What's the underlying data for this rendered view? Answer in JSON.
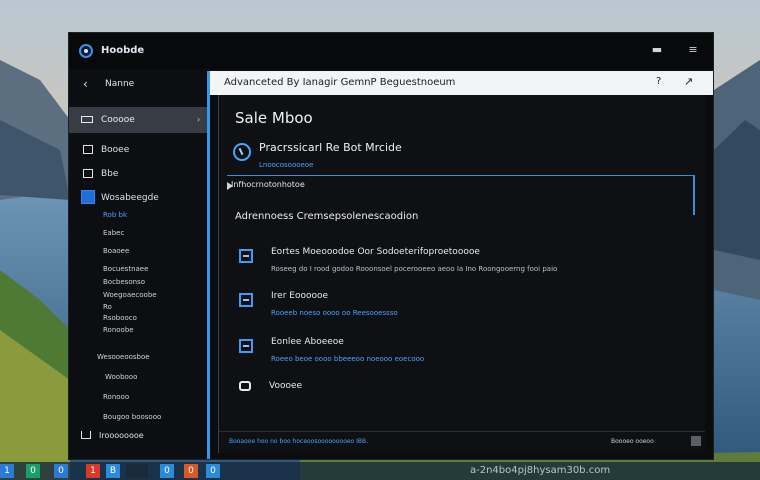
{
  "window": {
    "app_title": "Hoobde",
    "minimize_glyph": "▬",
    "menu_glyph": "≡"
  },
  "sidebar": {
    "back_label": "Nanne",
    "active_item": "Cooooe",
    "items": [
      {
        "label": "Booee",
        "icon": "square-icon"
      },
      {
        "label": "Bbe",
        "icon": "file-icon"
      },
      {
        "label": "Wosabeegde",
        "icon": "blue-square-icon",
        "highlight": true
      }
    ],
    "subitems": [
      {
        "label": "Rob bk",
        "blue": true
      },
      {
        "label": "Eabec",
        "blue": false
      },
      {
        "label": "Boaoee",
        "blue": false
      },
      {
        "label": "Bocuestnaee",
        "blue": false
      },
      {
        "label": "Bocbesonso",
        "blue": false
      },
      {
        "label": "Woegoaecoobe",
        "blue": false
      },
      {
        "label": "Ro",
        "blue": false
      },
      {
        "label": "Rsobooco",
        "blue": false
      },
      {
        "label": "Ronoobe",
        "blue": false
      },
      {
        "label": "Wesooeoosboe",
        "blue": false
      },
      {
        "label": "Woobooo",
        "blue": false
      },
      {
        "label": "Ronooo",
        "blue": false
      },
      {
        "label": "Bougoo boosooo",
        "blue": false
      }
    ],
    "bottom_label": "Iroooooooe"
  },
  "main": {
    "header_title": "Advanceted By Ianagir GemnP Beguestnoeum",
    "header_icon_1": "?",
    "header_icon_2": "↗",
    "section_title": "Sale Mboo",
    "feature_title": "Pracrssicarl Re Bot Mrcide",
    "feature_sub": "Lnoocosoooeoe",
    "focus_label": "Infhocrnotonhotoe",
    "group_title": "Adrennoess Cremsepsolenescaodion",
    "rows": [
      {
        "title": "Eortes Moeooodoe Oor Sodoeterifoproetooooe",
        "desc": "Roseeg do I rood godoo Rooonsoel pocerooeeo aeoo Ia Ino Roongooerng fooi paio",
        "blue": false
      },
      {
        "title": "Irer Eoooooe",
        "desc": "Rooeeb noeso oooo oo Reesooessso",
        "blue": true
      },
      {
        "title": "Eonlee Aboeeoe",
        "desc": "Roeeo beoe oooo bbeeeoo noeooo eoecooo",
        "blue": true
      }
    ],
    "vbox_label": "Voooee",
    "status_left": "Booaooe hoo no boo hoceoosooooooooeo IBB.",
    "status_right": "Boooeo ooeoo"
  },
  "taskbar": {
    "watermark": "a-2n4bo4pj8hysam30b.com",
    "icons": [
      {
        "glyph": "1",
        "color": "#2a7bd8"
      },
      {
        "glyph": "0",
        "color": "#1a9e6a"
      },
      {
        "glyph": "0",
        "color": "#2a7bd8"
      },
      {
        "glyph": "1",
        "color": "#d83a2a"
      },
      {
        "glyph": "B",
        "color": "#2a8bd8"
      },
      {
        "glyph": "",
        "color": "#1b2a3a"
      },
      {
        "glyph": "0",
        "color": "#2a8bd8"
      },
      {
        "glyph": "0",
        "color": "#d8582a"
      },
      {
        "glyph": "0",
        "color": "#2a8bd8"
      }
    ]
  }
}
